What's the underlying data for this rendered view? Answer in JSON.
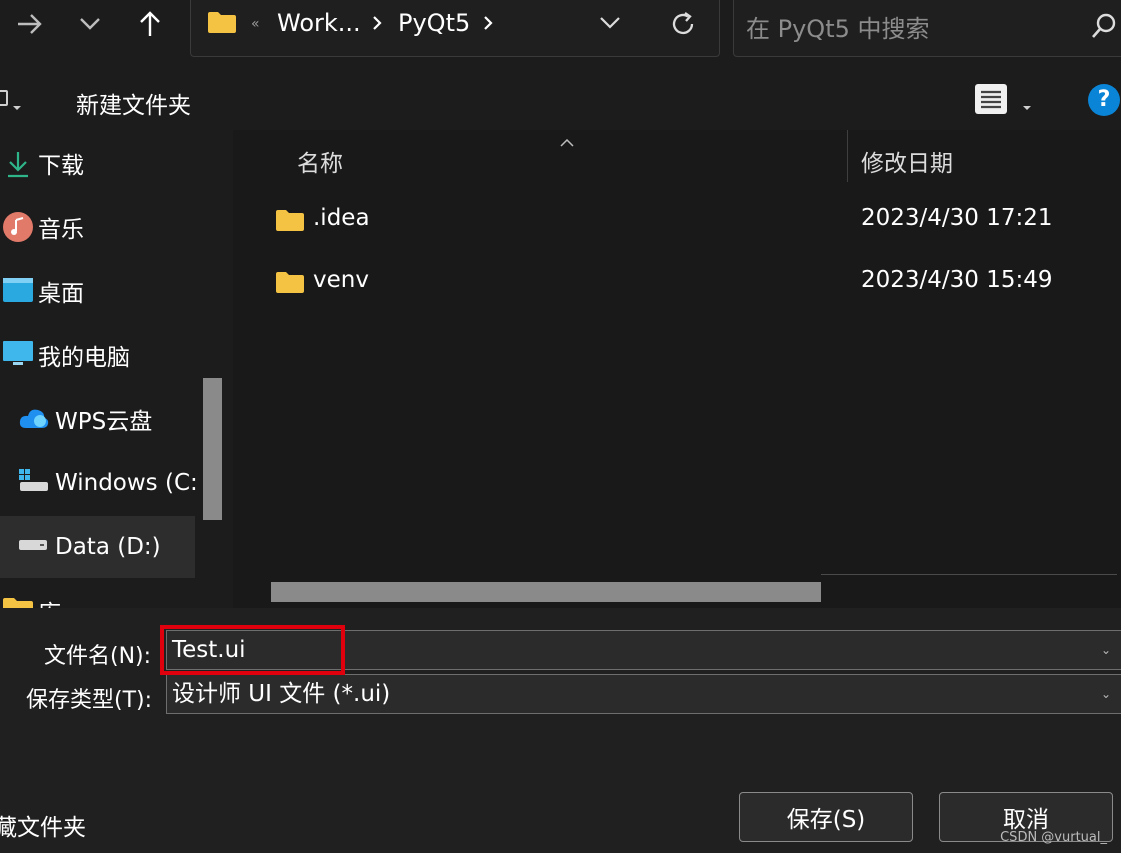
{
  "topbar": {
    "breadcrumbs": [
      "Work...",
      "PyQt5"
    ],
    "crumb_sep": "«",
    "search_placeholder": "在 PyQt5 中搜索"
  },
  "cmdbar": {
    "new_folder": "新建文件夹",
    "help": "?"
  },
  "nav": {
    "items": [
      {
        "label": "下载",
        "icon": "download-icon"
      },
      {
        "label": "音乐",
        "icon": "music-icon"
      },
      {
        "label": "桌面",
        "icon": "desktop-icon"
      },
      {
        "label": "我的电脑",
        "icon": "computer-icon"
      },
      {
        "label": "WPS云盘",
        "icon": "cloud-icon"
      },
      {
        "label": "Windows (C:",
        "icon": "drive-icon"
      },
      {
        "label": "Data (D:)",
        "icon": "drive-icon",
        "selected": true
      },
      {
        "label": "库",
        "icon": "folder-icon"
      }
    ]
  },
  "filelist": {
    "columns": [
      "名称",
      "修改日期"
    ],
    "rows": [
      {
        "name": ".idea",
        "modified": "2023/4/30 17:21"
      },
      {
        "name": "venv",
        "modified": "2023/4/30 15:49"
      }
    ]
  },
  "form": {
    "filename_label": "文件名(N):",
    "filename_value": "Test.ui",
    "filetype_label": "保存类型(T):",
    "filetype_value": "设计师 UI 文件 (*.ui)",
    "hide_folders": "藏文件夹",
    "save_button": "保存(S)",
    "cancel_button": "取消"
  },
  "watermark": "CSDN @vurtual_",
  "colors": {
    "accent_blue": "#0a84d6",
    "folder_yellow": "#f5c343",
    "highlight_red": "#e0000d"
  }
}
